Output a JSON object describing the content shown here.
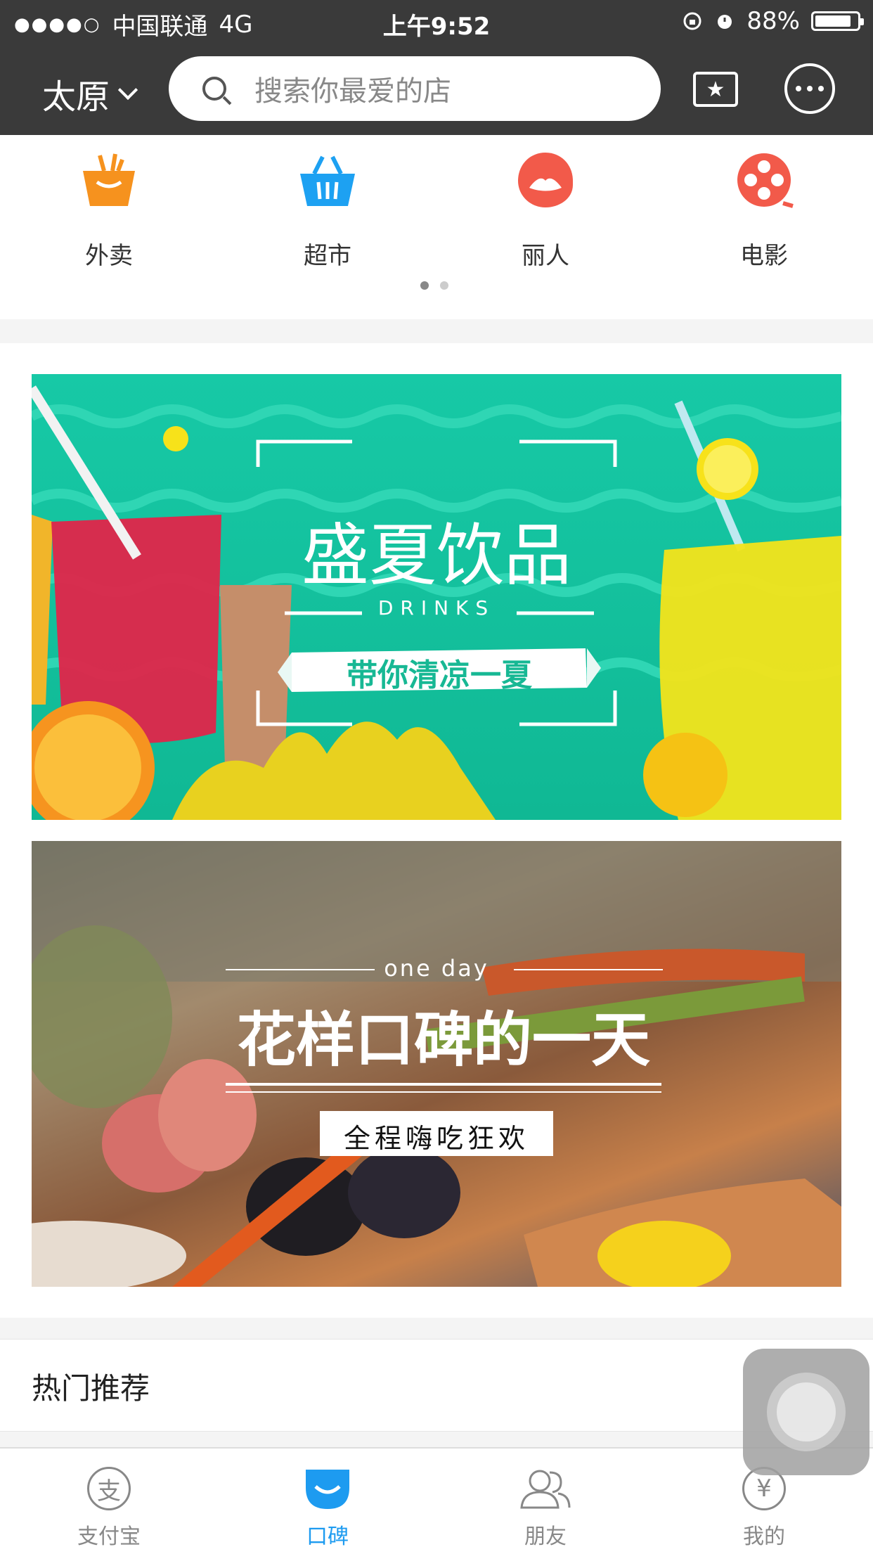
{
  "statusbar": {
    "carrier": "中国联通",
    "network": "4G",
    "time": "上午9:52",
    "battery": "88%",
    "signal_dots": "●●●●○"
  },
  "navbar": {
    "city": "太原",
    "search_placeholder": "搜索你最爱的店"
  },
  "categories": [
    {
      "label": "外卖",
      "icon": "takeout-bag-icon",
      "color": "#f6921e"
    },
    {
      "label": "超市",
      "icon": "shopping-basket-icon",
      "color": "#1da1f2"
    },
    {
      "label": "丽人",
      "icon": "beauty-icon",
      "color": "#f25a4a"
    },
    {
      "label": "电影",
      "icon": "film-reel-icon",
      "color": "#f25a4a"
    }
  ],
  "pager": {
    "pages": 2,
    "active": 1
  },
  "banners": [
    {
      "title": "盛夏饮品",
      "subtitle": "DRINKS",
      "tagline": "带你清凉一夏"
    },
    {
      "title": "花样口碑的一天",
      "subtitle": "one day",
      "tagline": "全程嗨吃狂欢"
    }
  ],
  "section": {
    "title": "热门推荐"
  },
  "tabbar": [
    {
      "label": "支付宝",
      "icon": "alipay-icon"
    },
    {
      "label": "口碑",
      "icon": "koubei-icon",
      "active": true
    },
    {
      "label": "朋友",
      "icon": "friends-icon"
    },
    {
      "label": "我的",
      "icon": "wallet-yuan-icon"
    }
  ],
  "colors": {
    "accent": "#1d9bf0",
    "navbar": "#3a3a3a",
    "drinks_banner": "#17c9a6"
  }
}
